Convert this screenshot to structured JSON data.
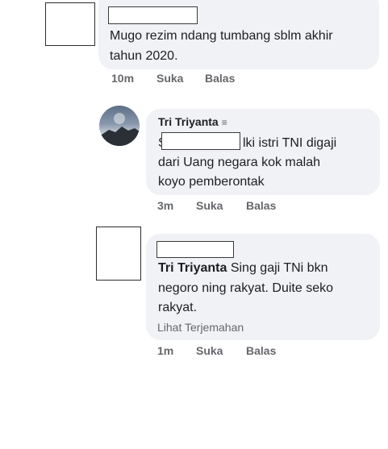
{
  "comments": [
    {
      "text": "Mugo rezim ndang tumbang sblm akhir tahun 2020.",
      "time": "10m",
      "like": "Suka",
      "reply": "Balas"
    },
    {
      "author": "Tri Triyanta",
      "author_badge": "≡",
      "prefix": "S",
      "text_after_redact": "lki istri TNI digaji",
      "text_rest_1": "dari Uang negara kok malah",
      "text_rest_2": "koyo pemberontak",
      "time": "3m",
      "like": "Suka",
      "reply": "Balas"
    },
    {
      "inline_author": "Tri Triyanta",
      "text_1": " Sing gaji TNi bkn",
      "text_2": "negoro ning rakyat. Duite seko",
      "text_3": "rakyat.",
      "translate": "Lihat Terjemahan",
      "time": "1m",
      "like": "Suka",
      "reply": "Balas"
    }
  ]
}
